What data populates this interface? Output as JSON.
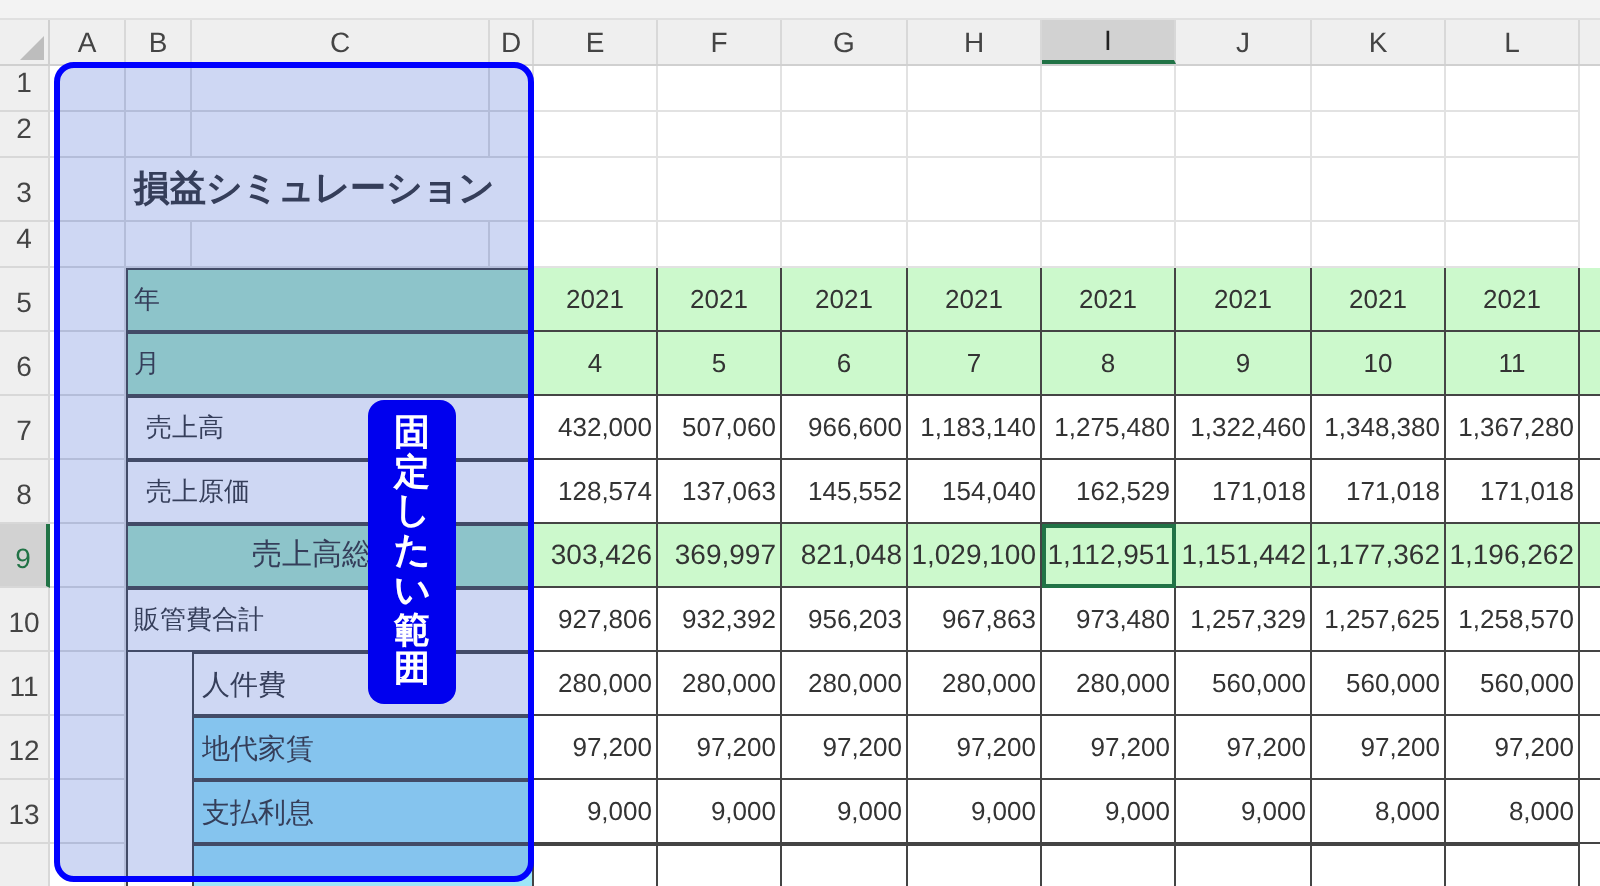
{
  "columns": [
    {
      "label": "A",
      "selected": false
    },
    {
      "label": "B",
      "selected": false
    },
    {
      "label": "C",
      "selected": false
    },
    {
      "label": "D",
      "selected": false
    },
    {
      "label": "E",
      "selected": false
    },
    {
      "label": "F",
      "selected": false
    },
    {
      "label": "G",
      "selected": false
    },
    {
      "label": "H",
      "selected": false
    },
    {
      "label": "I",
      "selected": true
    },
    {
      "label": "J",
      "selected": false
    },
    {
      "label": "K",
      "selected": false
    },
    {
      "label": "L",
      "selected": false
    }
  ],
  "rows": [
    {
      "number": "1",
      "kind": "blank",
      "selected": false
    },
    {
      "number": "2",
      "kind": "blank",
      "selected": false
    },
    {
      "number": "3",
      "kind": "title",
      "label": "損益シミュレーション",
      "selected": false
    },
    {
      "number": "4",
      "kind": "blank",
      "selected": false
    },
    {
      "number": "5",
      "kind": "header",
      "label": "年",
      "values": [
        "2021",
        "2021",
        "2021",
        "2021",
        "2021",
        "2021",
        "2021",
        "2021"
      ],
      "selected": false
    },
    {
      "number": "6",
      "kind": "header",
      "label": "月",
      "values": [
        "4",
        "5",
        "6",
        "7",
        "8",
        "9",
        "10",
        "11"
      ],
      "selected": false
    },
    {
      "number": "7",
      "kind": "item",
      "label": "売上高",
      "values": [
        "432,000",
        "507,060",
        "966,600",
        "1,183,140",
        "1,275,480",
        "1,322,460",
        "1,348,380",
        "1,367,280"
      ],
      "selected": false
    },
    {
      "number": "8",
      "kind": "item",
      "label": "売上原価",
      "values": [
        "128,574",
        "137,063",
        "145,552",
        "154,040",
        "162,529",
        "171,018",
        "171,018",
        "171,018"
      ],
      "selected": false
    },
    {
      "number": "9",
      "kind": "total",
      "label": "売上高総",
      "values": [
        "303,426",
        "369,997",
        "821,048",
        "1,029,100",
        "1,112,951",
        "1,151,442",
        "1,177,362",
        "1,196,262"
      ],
      "selected": true
    },
    {
      "number": "10",
      "kind": "group",
      "label": "販管費合計",
      "values": [
        "927,806",
        "932,392",
        "956,203",
        "967,863",
        "973,480",
        "1,257,329",
        "1,257,625",
        "1,258,570"
      ],
      "selected": false,
      "children": [
        {
          "number": "11",
          "kind": "sub",
          "label": "人件費",
          "values": [
            "280,000",
            "280,000",
            "280,000",
            "280,000",
            "280,000",
            "560,000",
            "560,000",
            "560,000"
          ],
          "selected": false
        },
        {
          "number": "12",
          "kind": "sub-highlight",
          "label": "地代家賃",
          "values": [
            "97,200",
            "97,200",
            "97,200",
            "97,200",
            "97,200",
            "97,200",
            "97,200",
            "97,200"
          ],
          "selected": false
        },
        {
          "number": "13",
          "kind": "sub-highlight",
          "label": "支払利息",
          "values": [
            "9,000",
            "9,000",
            "9,000",
            "9,000",
            "9,000",
            "9,000",
            "8,000",
            "8,000"
          ],
          "selected": false
        }
      ]
    }
  ],
  "frozen_range": {
    "label": "固定したい範囲"
  }
}
